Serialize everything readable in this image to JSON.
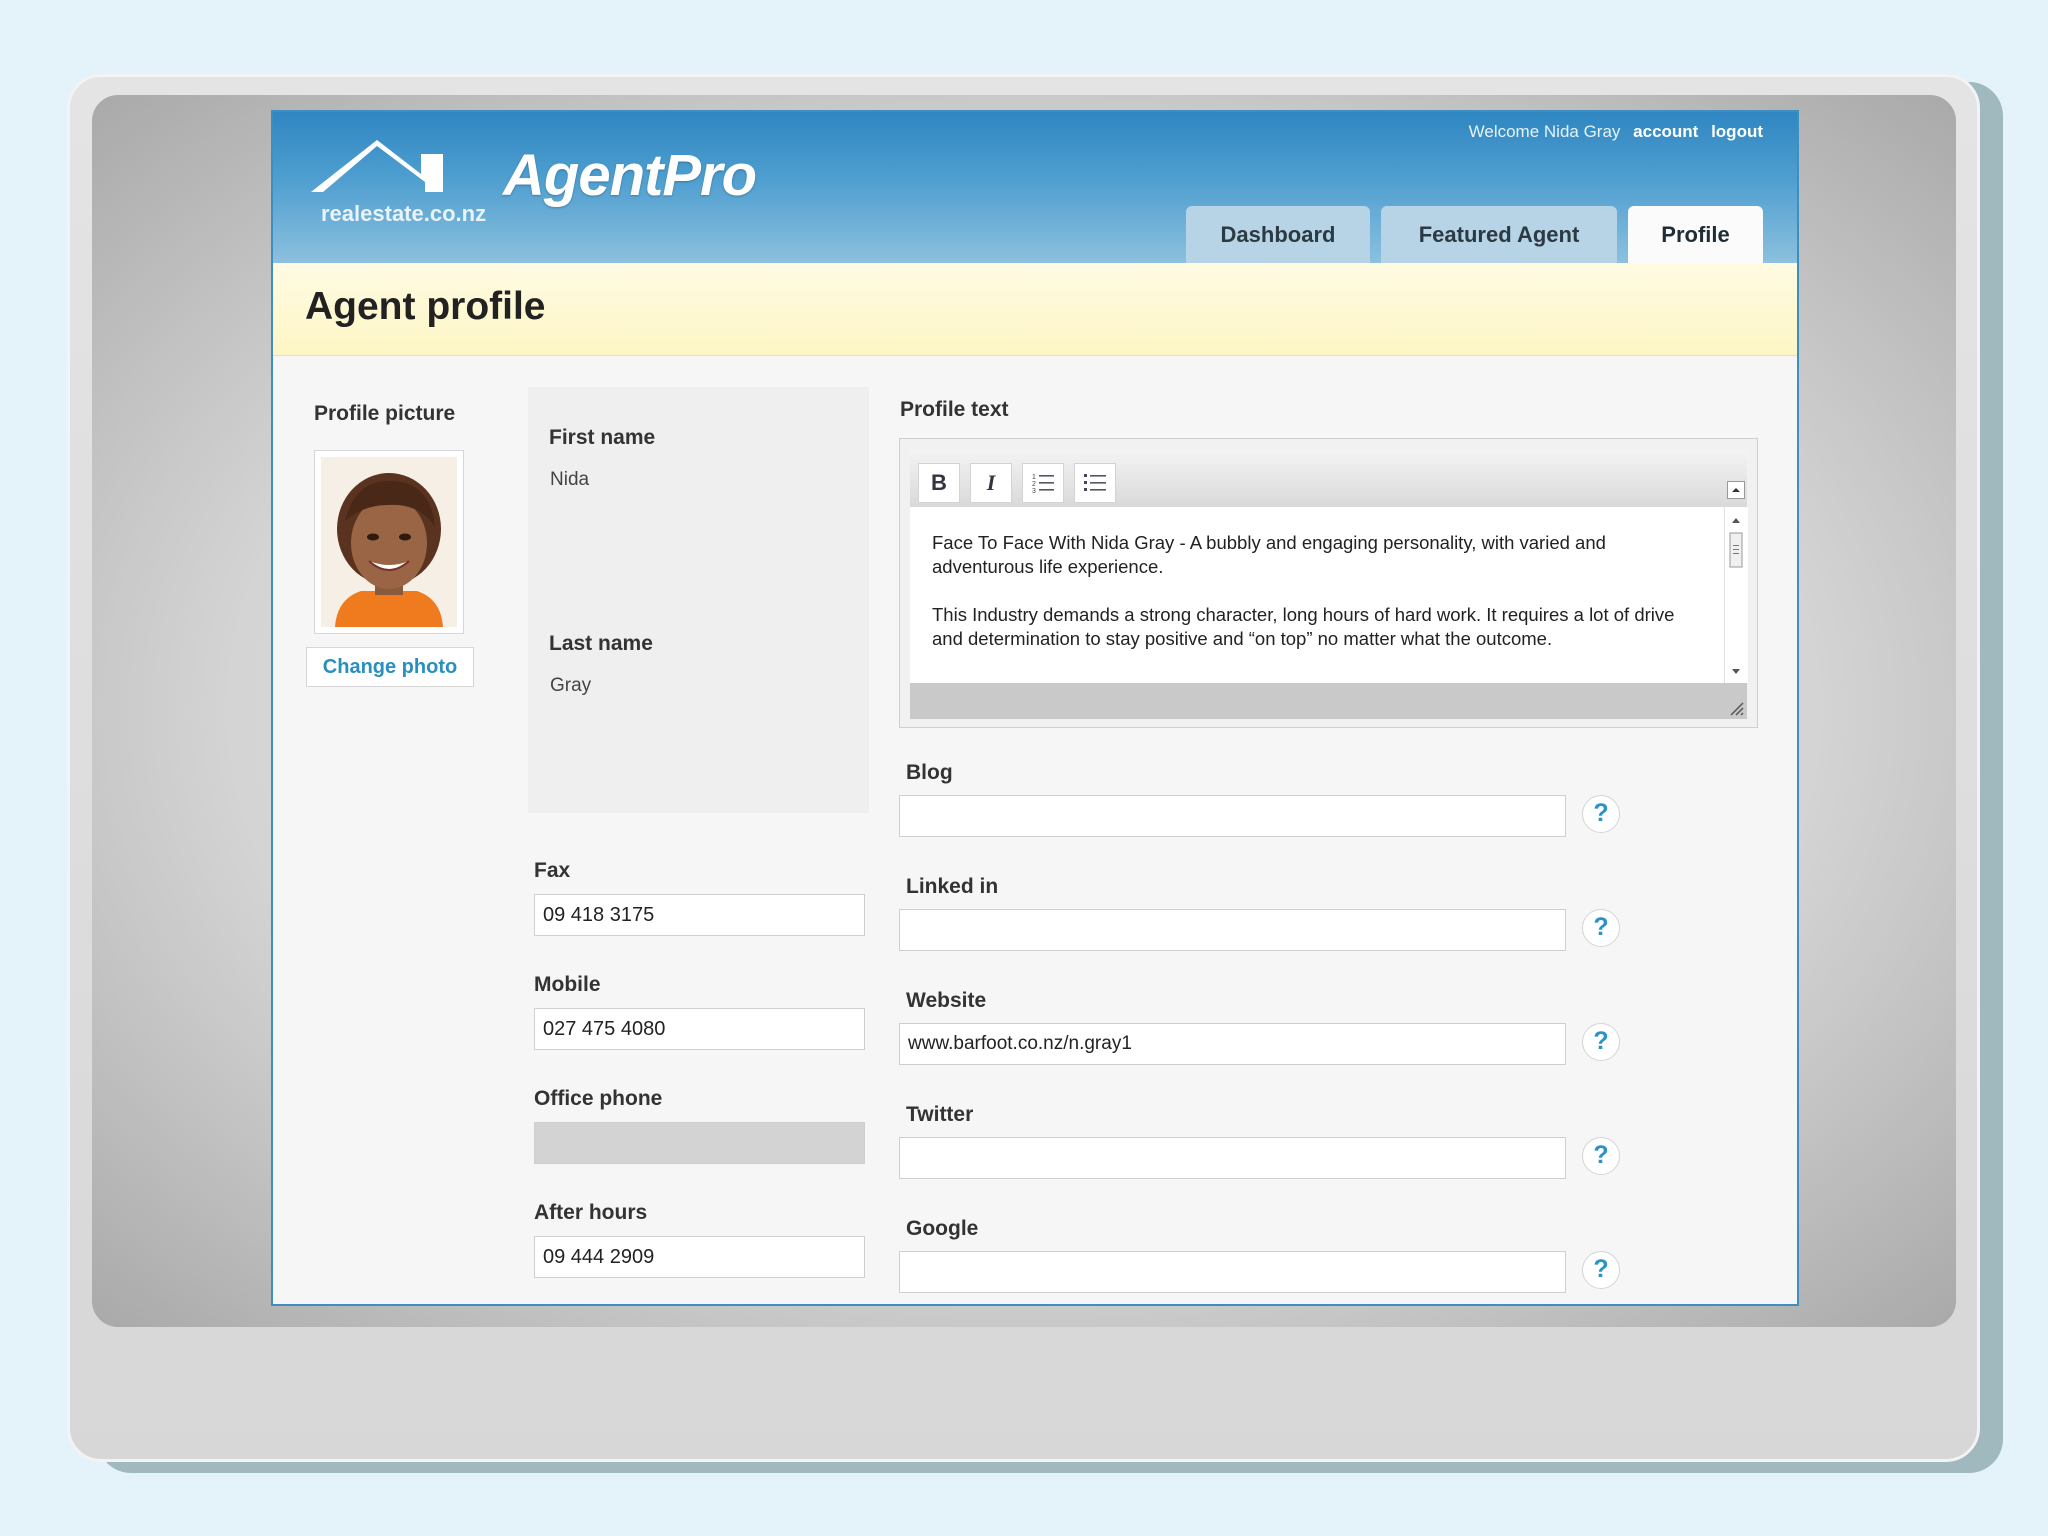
{
  "header": {
    "logo_text": "AgentPro",
    "logo_subtext": "realestate.co.nz",
    "welcome": "Welcome Nida Gray",
    "account_link": "account",
    "logout_link": "logout",
    "tabs": [
      {
        "label": "Dashboard"
      },
      {
        "label": "Featured Agent"
      },
      {
        "label": "Profile",
        "active": true
      }
    ]
  },
  "page_title": "Agent profile",
  "profile_picture": {
    "label": "Profile picture",
    "change_button": "Change photo"
  },
  "names": {
    "first_name_label": "First name",
    "first_name": "Nida",
    "last_name_label": "Last name",
    "last_name": "Gray"
  },
  "contacts": {
    "fax_label": "Fax",
    "fax": "09 418 3175",
    "mobile_label": "Mobile",
    "mobile": "027 475 4080",
    "office_phone_label": "Office phone",
    "office_phone": "",
    "after_hours_label": "After hours",
    "after_hours": "09 444 2909"
  },
  "profile_text": {
    "label": "Profile text",
    "toolbar": [
      "B",
      "I",
      "ordered-list-icon",
      "bullet-list-icon"
    ],
    "paragraphs": [
      "Face To Face With Nida Gray - A bubbly and engaging personality, with varied and adventurous life experience.",
      "This Industry demands a strong character, long hours of hard work. It requires a lot of drive and determination to stay positive and “on top” no matter what the outcome."
    ]
  },
  "links": {
    "blog_label": "Blog",
    "blog": "",
    "linkedin_label": "Linked in",
    "linkedin": "",
    "website_label": "Website",
    "website": "www.barfoot.co.nz/n.gray1",
    "twitter_label": "Twitter",
    "twitter": "",
    "google_label": "Google",
    "google": "",
    "help_glyph": "?"
  },
  "colors": {
    "header_blue": "#2f86c1",
    "accent": "#2a93c6",
    "title_bg": "#fdf6c4"
  }
}
